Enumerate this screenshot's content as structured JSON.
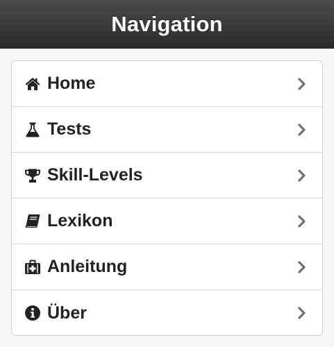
{
  "header": {
    "title": "Navigation"
  },
  "colors": {
    "bar_top": "#4b4b4b",
    "bar_bottom": "#2b2b2b",
    "text": "#222222",
    "chevron": "#707070"
  },
  "nav": {
    "items": [
      {
        "label": "Home",
        "icon": "home-icon"
      },
      {
        "label": "Tests",
        "icon": "flask-icon"
      },
      {
        "label": "Skill-Levels",
        "icon": "trophy-icon"
      },
      {
        "label": "Lexikon",
        "icon": "book-icon"
      },
      {
        "label": "Anleitung",
        "icon": "medkit-icon"
      },
      {
        "label": "Über",
        "icon": "info-icon"
      }
    ]
  }
}
